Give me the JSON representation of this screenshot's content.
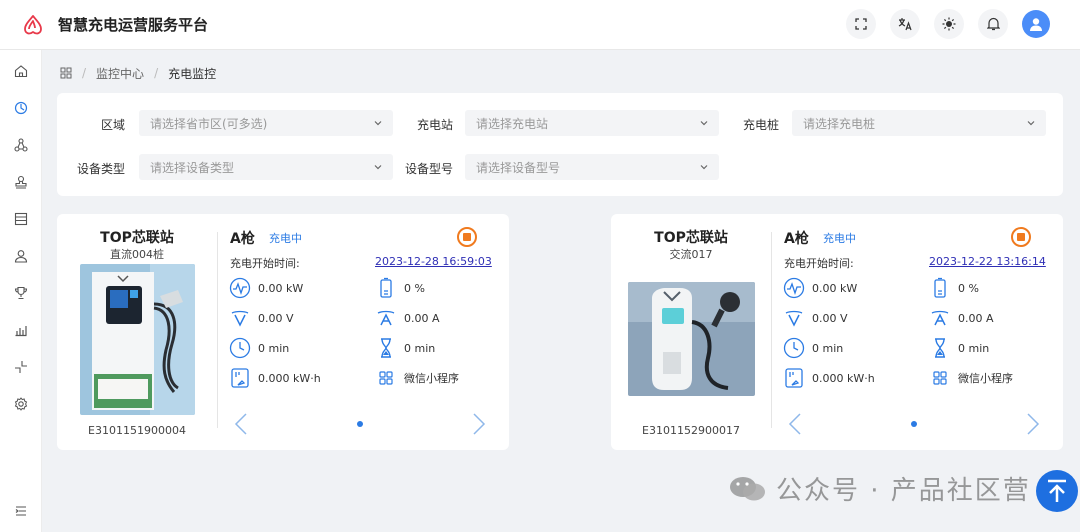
{
  "app": {
    "title": "智慧充电运营服务平台"
  },
  "header_actions": [
    {
      "name": "fullscreen-icon"
    },
    {
      "name": "translate-icon"
    },
    {
      "name": "theme-icon"
    },
    {
      "name": "bell-icon"
    },
    {
      "name": "avatar-icon"
    }
  ],
  "sidebar": {
    "items": [
      "home-icon",
      "monitor-icon",
      "network-icon",
      "stamp-icon",
      "list-icon",
      "user-icon",
      "trophy-icon",
      "chart-icon",
      "shrink-icon",
      "settings-icon"
    ],
    "collapse": "collapse-icon"
  },
  "breadcrumb": {
    "home": "grid-icon",
    "level1": "监控中心",
    "level2": "充电监控",
    "sep": "/"
  },
  "filters": {
    "region": {
      "label": "区域",
      "placeholder": "请选择省市区(可多选)"
    },
    "station": {
      "label": "充电站",
      "placeholder": "请选择充电站"
    },
    "pile": {
      "label": "充电桩",
      "placeholder": "请选择充电桩"
    },
    "device_type": {
      "label": "设备类型",
      "placeholder": "请选择设备类型"
    },
    "device_model": {
      "label": "设备型号",
      "placeholder": "请选择设备型号"
    }
  },
  "cards": [
    {
      "station": "TOP芯联站",
      "pile": "直流004桩",
      "device_code": "E3101151900004",
      "gun": "A枪",
      "status": "充电中",
      "start_label": "充电开始时间:",
      "start_time": "2023-12-28 16:59:03",
      "power": "0.00 kW",
      "soc": "0 %",
      "voltage": "0.00 V",
      "current": "0.00 A",
      "duration": "0 min",
      "remaining": "0 min",
      "energy": "0.000 kW·h",
      "source": "微信小程序"
    },
    {
      "station": "TOP芯联站",
      "pile": "交流017",
      "device_code": "E3101152900017",
      "gun": "A枪",
      "status": "充电中",
      "start_label": "充电开始时间:",
      "start_time": "2023-12-22 13:16:14",
      "power": "0.00 kW",
      "soc": "0 %",
      "voltage": "0.00 V",
      "current": "0.00 A",
      "duration": "0 min",
      "remaining": "0 min",
      "energy": "0.000 kW·h",
      "source": "微信小程序"
    }
  ],
  "watermark": "公众号 · 产品社区营",
  "colors": {
    "accent": "#2b7be4",
    "stop": "#f07a1e",
    "link": "#2f2fb5",
    "logo": "#e8394a"
  }
}
